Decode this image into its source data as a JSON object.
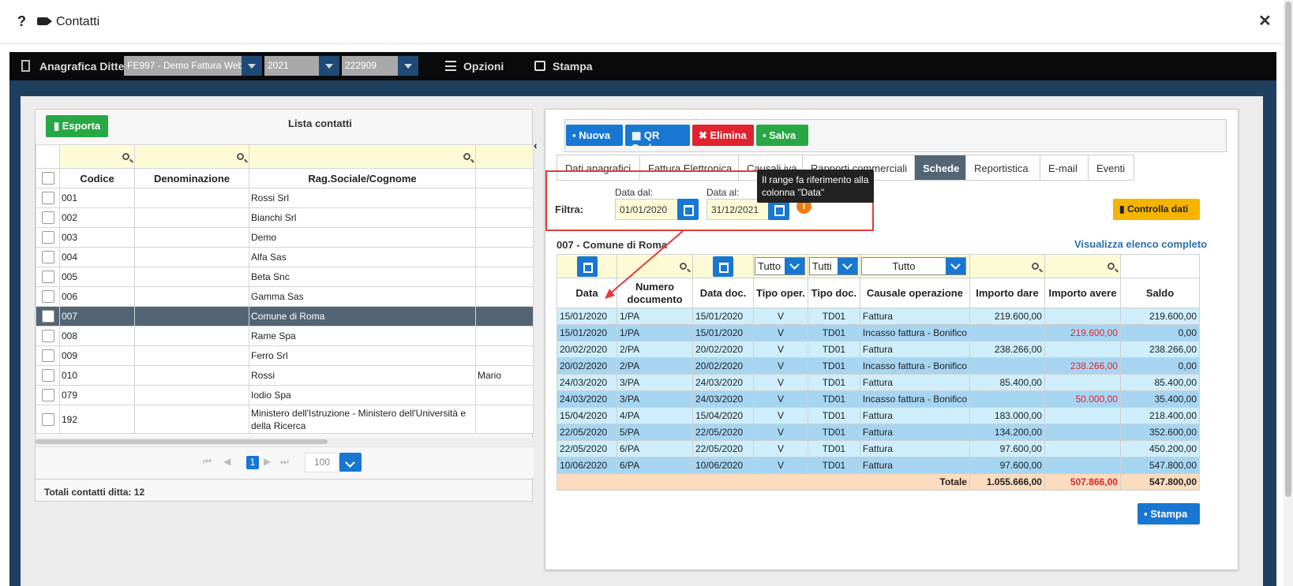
{
  "window": {
    "title": "Contatti",
    "help": "?",
    "close": "✕"
  },
  "topbar": {
    "label": "Anagrafica Ditte",
    "company_select": "FE997 - Demo Fattura Web",
    "year_select": "2021",
    "code_select": "222909",
    "opzioni": "Opzioni",
    "stampa": "Stampa"
  },
  "left": {
    "esporta": "Esporta",
    "title": "Lista contatti",
    "columns": [
      "Codice",
      "Denominazione",
      "Rag.Sociale/Cognome"
    ],
    "rows": [
      {
        "codice": "001",
        "denominazione": "",
        "ragione": "Rossi Srl",
        "extra": ""
      },
      {
        "codice": "002",
        "denominazione": "",
        "ragione": "Bianchi Srl",
        "extra": ""
      },
      {
        "codice": "003",
        "denominazione": "",
        "ragione": "Demo",
        "extra": ""
      },
      {
        "codice": "004",
        "denominazione": "",
        "ragione": "Alfa Sas",
        "extra": ""
      },
      {
        "codice": "005",
        "denominazione": "",
        "ragione": "Beta Snc",
        "extra": ""
      },
      {
        "codice": "006",
        "denominazione": "",
        "ragione": "Gamma Sas",
        "extra": ""
      },
      {
        "codice": "007",
        "denominazione": "",
        "ragione": "Comune di Roma",
        "extra": ""
      },
      {
        "codice": "008",
        "denominazione": "",
        "ragione": "Rame Spa",
        "extra": ""
      },
      {
        "codice": "009",
        "denominazione": "",
        "ragione": "Ferro Srl",
        "extra": ""
      },
      {
        "codice": "010",
        "denominazione": "",
        "ragione": "Rossi",
        "extra": "Mario"
      },
      {
        "codice": "079",
        "denominazione": "",
        "ragione": "Iodio Spa",
        "extra": ""
      },
      {
        "codice": "192",
        "denominazione": "",
        "ragione": "Ministero dell'Istruzione - Ministero dell'Università e della Ricerca",
        "extra": ""
      }
    ],
    "selected_index": 6,
    "pager": {
      "current": "1",
      "page_size": "100"
    },
    "totali": "Totali contatti ditta: 12"
  },
  "right": {
    "buttons": {
      "nuova": "Nuova",
      "qrcode": "QR Code",
      "elimina": "Elimina",
      "salva": "Salva"
    },
    "tabs": [
      "Dati anagrafici",
      "Fattura Elettronica",
      "Causali iva",
      "Rapporti commerciali",
      "Schede",
      "Reportistica",
      "E-mail",
      "Eventi"
    ],
    "active_tab": "Schede",
    "filter": {
      "label": "Filtra:",
      "dal_label": "Data dal:",
      "dal_value": "01/01/2020",
      "al_label": "Data al:",
      "al_value": "31/12/2021",
      "tooltip": "Il range fa riferimento alla colonna \"Data\""
    },
    "controlla": "Controlla dati",
    "subject": "007 - Comune di Roma",
    "visualizza": "Visualizza elenco completo",
    "filter_selects": {
      "tipo_oper": "Tutto",
      "tipo_doc": "Tutti",
      "causale": "Tutto"
    },
    "columns": [
      "Data",
      "Numero documento",
      "Data doc.",
      "Tipo oper.",
      "Tipo doc.",
      "Causale operazione",
      "Importo dare",
      "Importo avere",
      "Saldo"
    ],
    "rows": [
      {
        "data": "15/01/2020",
        "num": "1/PA",
        "datadoc": "15/01/2020",
        "oper": "V",
        "tipodoc": "TD01",
        "causale": "Fattura",
        "dare": "219.600,00",
        "avere": "",
        "saldo": "219.600,00"
      },
      {
        "data": "15/01/2020",
        "num": "1/PA",
        "datadoc": "15/01/2020",
        "oper": "V",
        "tipodoc": "TD01",
        "causale": "Incasso fattura - Bonifico",
        "dare": "",
        "avere": "219.600,00",
        "saldo": "0,00"
      },
      {
        "data": "20/02/2020",
        "num": "2/PA",
        "datadoc": "20/02/2020",
        "oper": "V",
        "tipodoc": "TD01",
        "causale": "Fattura",
        "dare": "238.266,00",
        "avere": "",
        "saldo": "238.266,00"
      },
      {
        "data": "20/02/2020",
        "num": "2/PA",
        "datadoc": "20/02/2020",
        "oper": "V",
        "tipodoc": "TD01",
        "causale": "Incasso fattura - Bonifico",
        "dare": "",
        "avere": "238.266,00",
        "saldo": "0,00"
      },
      {
        "data": "24/03/2020",
        "num": "3/PA",
        "datadoc": "24/03/2020",
        "oper": "V",
        "tipodoc": "TD01",
        "causale": "Fattura",
        "dare": "85.400,00",
        "avere": "",
        "saldo": "85.400,00"
      },
      {
        "data": "24/03/2020",
        "num": "3/PA",
        "datadoc": "24/03/2020",
        "oper": "V",
        "tipodoc": "TD01",
        "causale": "Incasso fattura - Bonifico",
        "dare": "",
        "avere": "50.000,00",
        "saldo": "35.400,00"
      },
      {
        "data": "15/04/2020",
        "num": "4/PA",
        "datadoc": "15/04/2020",
        "oper": "V",
        "tipodoc": "TD01",
        "causale": "Fattura",
        "dare": "183.000,00",
        "avere": "",
        "saldo": "218.400,00"
      },
      {
        "data": "22/05/2020",
        "num": "5/PA",
        "datadoc": "22/05/2020",
        "oper": "V",
        "tipodoc": "TD01",
        "causale": "Fattura",
        "dare": "134.200,00",
        "avere": "",
        "saldo": "352.600,00"
      },
      {
        "data": "22/05/2020",
        "num": "6/PA",
        "datadoc": "22/05/2020",
        "oper": "V",
        "tipodoc": "TD01",
        "causale": "Fattura",
        "dare": "97.600,00",
        "avere": "",
        "saldo": "450.200,00"
      },
      {
        "data": "10/06/2020",
        "num": "6/PA",
        "datadoc": "10/06/2020",
        "oper": "V",
        "tipodoc": "TD01",
        "causale": "Fattura",
        "dare": "97.600,00",
        "avere": "",
        "saldo": "547.800,00"
      }
    ],
    "totals": {
      "label": "Totale",
      "dare": "1.055.666,00",
      "avere": "507.866,00",
      "saldo": "547.800,00"
    },
    "stampa": "Stampa"
  },
  "colors": {
    "accent_blue": "#1877d2",
    "green": "#27a844",
    "red": "#e0232f",
    "orange": "#ee7d10",
    "yellow_button": "#f5b400",
    "selected_row": "#526574"
  }
}
